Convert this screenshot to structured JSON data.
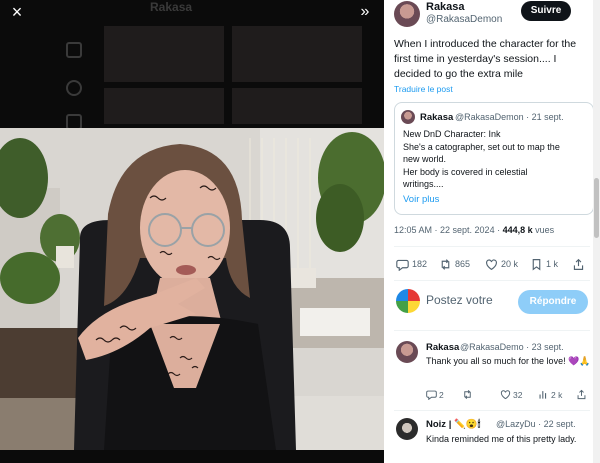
{
  "media": {
    "close_icon": "×",
    "next_icon": "»",
    "ghost_author": "Rakasa"
  },
  "post": {
    "author_name": "Rakasa",
    "author_handle": "@RakasaDemon",
    "follow_label": "Suivre",
    "text": "When I introduced the character for the first time in yesterday's session.... I decided to go the extra mile",
    "translate_label": "Traduire le post",
    "quote": {
      "author_name": "Rakasa",
      "author_handle": "@RakasaDemon · 21 sept.",
      "text_lines": [
        "New DnD Character: Ink",
        "She's a catographer, set out to map the",
        "new world.",
        "Her body is covered in celestial",
        "writings...."
      ],
      "more_label": "Voir plus"
    },
    "time": "12:05 AM · 22 sept. 2024 · ",
    "views_count": "444,8 k",
    "views_label": " vues",
    "stats": {
      "replies": "182",
      "reposts": "865",
      "likes": "20 k",
      "bookmarks": "1 k"
    }
  },
  "compose": {
    "placeholder": "Postez votre",
    "reply_button": "Répondre"
  },
  "replies": [
    {
      "name": "Rakasa",
      "handle": "@RakasaDemo · 23 sept.",
      "text": "Thank you all so much for the love! 💜🙏",
      "stats": {
        "replies": "2",
        "reposts": "",
        "likes": "32",
        "views": "2 k"
      }
    },
    {
      "name": "Noiz | ✏️😮🕯",
      "handle": "@LazyDu · 22 sept.",
      "text": "Kinda reminded me of this pretty lady."
    }
  ],
  "colors": {
    "accent": "#1d9bf0",
    "follow_bg": "#0f1419",
    "reply_button_bg": "#8ecdf8",
    "muted": "#536471"
  }
}
